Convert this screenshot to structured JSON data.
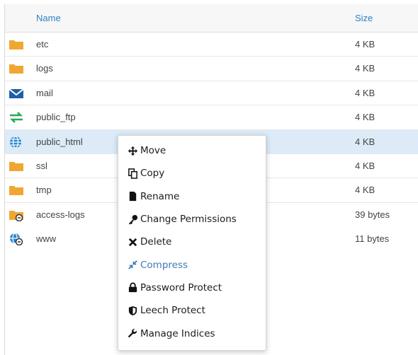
{
  "table": {
    "headers": {
      "name": "Name",
      "size": "Size"
    },
    "rows": [
      {
        "name": "etc",
        "size": "4 KB",
        "icon": "folder-icon"
      },
      {
        "name": "logs",
        "size": "4 KB",
        "icon": "folder-icon"
      },
      {
        "name": "mail",
        "size": "4 KB",
        "icon": "mail-icon"
      },
      {
        "name": "public_ftp",
        "size": "4 KB",
        "icon": "transfer-arrows-icon"
      },
      {
        "name": "public_html",
        "size": "4 KB",
        "icon": "globe-icon",
        "selected": true
      },
      {
        "name": "ssl",
        "size": "4 KB",
        "icon": "folder-icon"
      },
      {
        "name": "tmp",
        "size": "4 KB",
        "icon": "folder-icon"
      },
      {
        "name": "access-logs",
        "size": "39 bytes",
        "icon": "folder-link-icon"
      },
      {
        "name": "www",
        "size": "11 bytes",
        "icon": "globe-link-icon"
      }
    ]
  },
  "context_menu": {
    "items": [
      {
        "label": "Move",
        "icon": "move-arrows-icon"
      },
      {
        "label": "Copy",
        "icon": "copy-icon"
      },
      {
        "label": "Rename",
        "icon": "file-icon"
      },
      {
        "label": "Change Permissions",
        "icon": "key-icon"
      },
      {
        "label": "Delete",
        "icon": "delete-x-icon"
      },
      {
        "label": "Compress",
        "icon": "compress-icon",
        "state": "highlighted"
      },
      {
        "label": "Password Protect",
        "icon": "lock-icon"
      },
      {
        "label": "Leech Protect",
        "icon": "shield-icon"
      },
      {
        "label": "Manage Indices",
        "icon": "wrench-icon"
      }
    ]
  },
  "colors": {
    "accent": "#2d82c4",
    "folder": "#f0a731",
    "selected_row": "#dcebf7",
    "ftp_green": "#2aa65a"
  }
}
